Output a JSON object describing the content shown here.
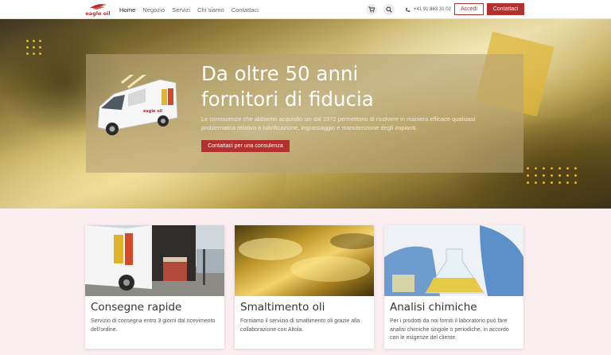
{
  "brand": {
    "logo_text": "eagle oil",
    "accent": "#b2302d"
  },
  "nav": {
    "items": [
      {
        "label": "Home",
        "active": true
      },
      {
        "label": "Negozio",
        "active": false
      },
      {
        "label": "Servizi",
        "active": false
      },
      {
        "label": "Chi siamo",
        "active": false
      },
      {
        "label": "Contattaci",
        "active": false
      }
    ],
    "cart_icon": "cart-icon",
    "search_icon": "search-icon",
    "phone_icon": "phone-icon",
    "phone": "+41 91 863 31 02",
    "login_label": "Accedi",
    "contact_label": "Contattaci"
  },
  "hero": {
    "title_line1": "Da oltre 50 anni",
    "title_line2": "fornitori di fiducia",
    "description": "Le conoscenze che abbiamo acquisito sin dal 1972 permettono di risolvere in maniera efficace qualsiasi problematica relativa a lubrificazione, ingrassaggio e manutenzione degli impianti.",
    "cta_label": "Contattaci per una consulenza",
    "van_text": "eagle oil"
  },
  "cards": [
    {
      "title": "Consegne rapide",
      "text": "Servizio di consegna entro 3 giorni dal ricevimento dell'ordine."
    },
    {
      "title": "Smaltimento oli",
      "text": "Forniamo il servizio di smaltimento oli grazie alla collaborazione con Altola."
    },
    {
      "title": "Analisi chimiche",
      "text": "Per i prodotti da noi forniti il laboratorio può fare analisi chimiche singole o periodiche, in accordo con le esigenze del cliente."
    }
  ]
}
